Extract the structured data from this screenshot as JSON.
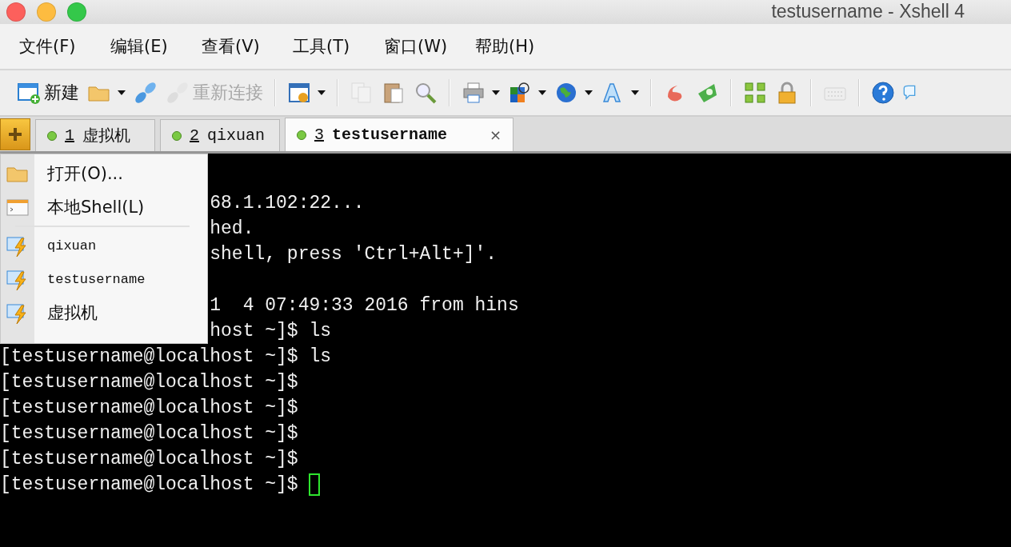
{
  "window": {
    "title": "testusername - Xshell 4"
  },
  "menu_bar": [
    "文件(F)",
    "编辑(E)",
    "查看(V)",
    "工具(T)",
    "窗口(W)",
    "帮助(H)"
  ],
  "toolbar": {
    "groups": [
      [
        {
          "label": "新建",
          "dropdown": false,
          "disabled": false
        },
        {
          "dropdown": true,
          "disabled": false
        },
        {
          "dropdown": false,
          "disabled": false
        },
        {
          "label": "重新连接",
          "dropdown": false,
          "disabled": true
        }
      ],
      [
        {
          "dropdown": true,
          "disabled": false
        }
      ],
      [
        {
          "dropdown": false,
          "disabled": true
        },
        {
          "dropdown": false,
          "disabled": false
        },
        {
          "dropdown": false,
          "disabled": false
        }
      ],
      [
        {
          "dropdown": true,
          "disabled": false
        },
        {
          "dropdown": true,
          "disabled": false
        },
        {
          "dropdown": true,
          "disabled": false
        },
        {
          "dropdown": true,
          "disabled": false
        }
      ],
      [
        {
          "dropdown": false,
          "disabled": false
        },
        {
          "dropdown": false,
          "disabled": false
        }
      ],
      [
        {
          "dropdown": false,
          "disabled": false
        },
        {
          "dropdown": false,
          "disabled": false
        }
      ],
      [
        {
          "dropdown": false,
          "disabled": true
        }
      ],
      [
        {
          "dropdown": false,
          "disabled": false
        },
        {
          "dropdown": false,
          "disabled": false
        }
      ]
    ]
  },
  "tabs": [
    {
      "number": "1",
      "name": "虚拟机",
      "selected": false
    },
    {
      "number": "2",
      "name": "qixuan",
      "selected": false
    },
    {
      "number": "3",
      "name": "testusername",
      "selected": true,
      "close": "×"
    }
  ],
  "session_menu": {
    "items": [
      {
        "kind": "open",
        "label": "打开(O)..."
      },
      {
        "kind": "local",
        "label": "本地Shell(L)"
      },
      {
        "kind": "separator"
      },
      {
        "kind": "session",
        "label": "qixuan"
      },
      {
        "kind": "session",
        "label": "testusername"
      },
      {
        "kind": "session",
        "label": "虚拟机"
      }
    ]
  },
  "terminal": {
    "cursor": true,
    "lines": [
      {
        "kind": "covered",
        "text": "68.1.102:22..."
      },
      {
        "kind": "covered",
        "text": "hed."
      },
      {
        "kind": "covered",
        "text": "shell, press 'Ctrl+Alt+]'."
      },
      {
        "kind": "blank"
      },
      {
        "kind": "covered",
        "text": "1  4 07:49:33 2016 from hins"
      },
      {
        "kind": "covered",
        "text": "host ~]$ ls"
      },
      {
        "kind": "full",
        "text": "[testusername@localhost ~]$ ls"
      },
      {
        "kind": "full",
        "text": "[testusername@localhost ~]$"
      },
      {
        "kind": "full",
        "text": "[testusername@localhost ~]$"
      },
      {
        "kind": "full",
        "text": "[testusername@localhost ~]$"
      },
      {
        "kind": "full",
        "text": "[testusername@localhost ~]$"
      },
      {
        "kind": "full",
        "text": "[testusername@localhost ~]$"
      }
    ]
  }
}
